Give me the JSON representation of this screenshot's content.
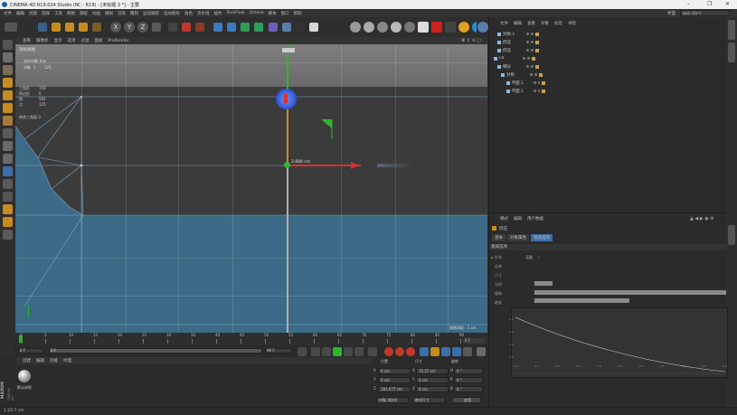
{
  "window": {
    "title": "CINEMA 4D R19.024 Studio (RC - R19) - [未标题 3 *] - 主要",
    "minimize": "–",
    "maximize": "❐",
    "close": "✕"
  },
  "menu": [
    "文件",
    "编辑",
    "创建",
    "选择",
    "工具",
    "网格",
    "捕捉",
    "动画",
    "模拟",
    "渲染",
    "雕刻",
    "运动跟踪",
    "运动图形",
    "角色",
    "流水线",
    "插件",
    "RealFlow",
    "Octane",
    "脚本",
    "窗口",
    "帮助"
  ],
  "layout": {
    "label": "界面",
    "value": "启动 (用户)"
  },
  "viewport": {
    "menu": [
      "查看",
      "摄像机",
      "显示",
      "选项",
      "过滤",
      "面板",
      "ProRender"
    ],
    "label": "透视视图",
    "info_title": "选中对象 合计",
    "info_obj": "对象",
    "info_obj_count": "1",
    "info_value": "125",
    "stats": [
      {
        "k": "三角形",
        "v": "158"
      },
      {
        "k": "四边形",
        "v": "0"
      },
      {
        "k": "线",
        "v": "591"
      },
      {
        "k": "点",
        "v": "125"
      }
    ],
    "stats_extra": "带状三角面 0",
    "dimension": "2.888 cm",
    "grid_spacing": "网格间距 : 1 cm",
    "colors": {
      "bg_top": "#7a7a7a",
      "bg": "#3b3b3b",
      "mesh": "#3d6a86",
      "axis_y": "#2eb52e",
      "axis_x": "#d83030",
      "accent": "#2a4fd1"
    }
  },
  "objects": {
    "tabs": [
      "文件",
      "编辑",
      "查看",
      "对象",
      "标签",
      "书签"
    ],
    "items": [
      "对称.1",
      "挤压",
      "挤压",
      "L0",
      "细分",
      "对称",
      "平面.1",
      "平面.1"
    ]
  },
  "timeline": {
    "ticks": [
      "0",
      "5",
      "10",
      "15",
      "20",
      "25",
      "30",
      "35",
      "40",
      "45",
      "50",
      "55",
      "60",
      "65",
      "70",
      "75",
      "80",
      "85",
      "90"
    ],
    "end_label": "0 F",
    "start": "0 F",
    "current": "0 F",
    "end": "90 F",
    "end2": "90 F"
  },
  "materials": {
    "tabs": [
      "创建",
      "编辑",
      "功能",
      "纹理"
    ],
    "item": "默认材质"
  },
  "coords": {
    "headers": [
      "位置",
      "尺寸",
      "旋转"
    ],
    "rows": [
      {
        "axis": "X",
        "pos": "0 cm",
        "size": "75.57 cm",
        "rot_label": "H",
        "rot": "0 °"
      },
      {
        "axis": "Y",
        "pos": "0 cm",
        "size": "0 cm",
        "rot_label": "P",
        "rot": "0 °"
      },
      {
        "axis": "Z",
        "pos": "181.077 cm",
        "size": "0 cm",
        "rot_label": "B",
        "rot": "0 °"
      }
    ],
    "mode": "对象 (相对)",
    "size_mode": "绝对尺寸",
    "apply": "应用"
  },
  "attributes": {
    "tabs": [
      "模式",
      "编辑",
      "用户数据"
    ],
    "object": "挤压",
    "sub_tabs": [
      "基本",
      "对象属性",
      "衰减选项"
    ],
    "section": "衰减选项",
    "rows": [
      {
        "k": "形状",
        "v": "无限",
        "check": "✓"
      },
      {
        "k": "反转",
        "v": "",
        "check": ""
      },
      {
        "k": "尺寸",
        "v": "",
        "check": ""
      },
      {
        "k": "比例",
        "v": "",
        "check": ""
      },
      {
        "k": "偏移",
        "v": "",
        "check": ""
      },
      {
        "k": "缩放",
        "v": "",
        "check": ""
      }
    ],
    "curve_labels_x": [
      "0.0",
      "0.1",
      "0.2",
      "0.3",
      "0.4",
      "0.5",
      "0.6",
      "0.7",
      "0.8",
      "0.9",
      "1.0"
    ],
    "curve_labels_y": [
      "0.8",
      "0.6",
      "0.4",
      "0.2"
    ]
  },
  "status": {
    "text": "1 23.7 cm"
  },
  "brand": {
    "line1": "MAXON",
    "line2": "CINEMA 4D"
  }
}
